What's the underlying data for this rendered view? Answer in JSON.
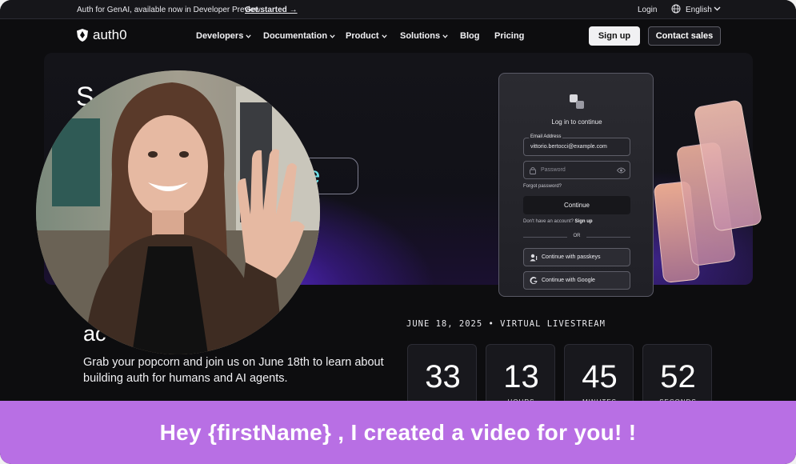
{
  "topbar": {
    "announcement": "Auth for GenAI, available now in Developer Preview.",
    "get_started": "Get started →",
    "login": "Login",
    "language": "English"
  },
  "nav": {
    "logo_text": "auth0",
    "items": [
      {
        "label": "Developers",
        "has_menu": true
      },
      {
        "label": "Documentation",
        "has_menu": true
      },
      {
        "label": "Product",
        "has_menu": true
      },
      {
        "label": "Solutions",
        "has_menu": true
      },
      {
        "label": "Blog",
        "has_menu": false
      },
      {
        "label": "Pricing",
        "has_menu": false
      }
    ],
    "signup": "Sign up",
    "contact": "Contact sales"
  },
  "hero": {
    "title_fragment": "S         es",
    "pill_fragment": "ne"
  },
  "login_card": {
    "title": "Log in to continue",
    "email_label": "Email Address",
    "email_value": "vittorio.bertocci@example.com",
    "password_placeholder": "Password",
    "forgot": "Forgot password?",
    "continue": "Continue",
    "no_account": "Don't have an account?",
    "signup_link": "Sign up",
    "or": "OR",
    "passkeys": "Continue with passkeys",
    "google": "Continue with Google"
  },
  "event": {
    "heading_fragment": "ac",
    "description": "Grab your popcorn and join us on June 18th to learn about building auth for humans and AI agents.",
    "date_line": "JUNE 18, 2025  •  VIRTUAL LIVESTREAM",
    "countdown": [
      {
        "value": "33",
        "unit": ""
      },
      {
        "value": "13",
        "unit": "HOURS"
      },
      {
        "value": "45",
        "unit": "MINUTES"
      },
      {
        "value": "52",
        "unit": "SECONDS"
      }
    ]
  },
  "banner": {
    "text": "Hey {firstName} ,  I created a video for you! !"
  },
  "colors": {
    "accent_purple": "#b86fe4",
    "hero_glow": "#5a2bd8",
    "pill_text": "#6de0e8"
  }
}
